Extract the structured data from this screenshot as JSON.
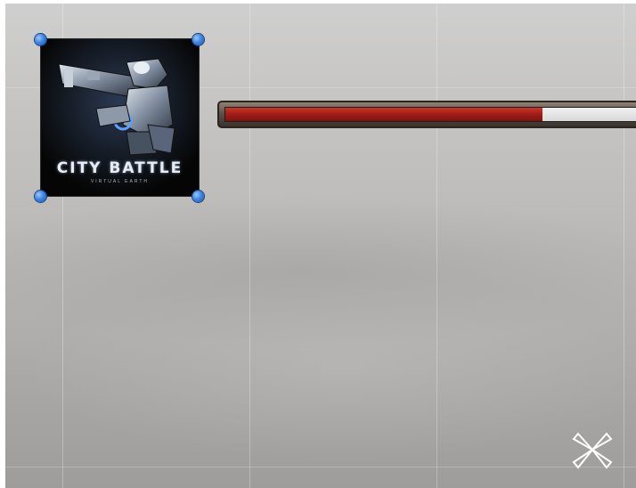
{
  "scene_view": {
    "background": "gray gradient scene view with reference grid"
  },
  "logo_widget": {
    "title": "CITY BATTLE",
    "subtitle": "VIRTUAL EARTH",
    "selected": true,
    "handle_color": "#3f86e0"
  },
  "progress_bar": {
    "fill_fraction": 0.76,
    "fill_color": "#a11d16",
    "track_color": "#e6e6e6",
    "frame_color": "#5c5248"
  },
  "gizmo": {
    "icon": "anchor-presets-icon",
    "color": "#ffffff"
  }
}
